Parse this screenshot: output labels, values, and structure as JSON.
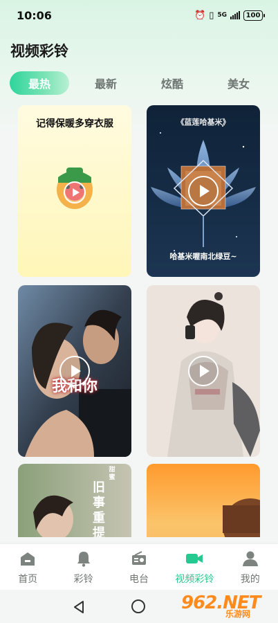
{
  "status_bar": {
    "time": "10:06",
    "network": "5G",
    "battery": "100"
  },
  "page": {
    "title": "视频彩铃"
  },
  "tabs": [
    {
      "label": "最热",
      "active": true
    },
    {
      "label": "最新",
      "active": false
    },
    {
      "label": "炫酷",
      "active": false
    },
    {
      "label": "美女",
      "active": false
    }
  ],
  "videos": [
    {
      "caption": "记得保暖多穿衣服"
    },
    {
      "caption_top": "《蓝莲哈基米》",
      "caption_bottom": "哈基米喔南北绿豆~"
    },
    {
      "caption": "我和你"
    },
    {
      "caption": ""
    },
    {
      "caption": "旧事重提",
      "caption_small": "甜蜜"
    },
    {
      "caption": ""
    }
  ],
  "bottom_nav": [
    {
      "label": "首页",
      "icon": "home-icon",
      "active": false
    },
    {
      "label": "彩铃",
      "icon": "bell-icon",
      "active": false
    },
    {
      "label": "电台",
      "icon": "radio-icon",
      "active": false
    },
    {
      "label": "视频彩铃",
      "icon": "video-camera-icon",
      "active": true
    },
    {
      "label": "我的",
      "icon": "user-icon",
      "active": false
    }
  ],
  "watermark": {
    "text": "962.NET",
    "subtext": "乐游网"
  },
  "colors": {
    "accent": "#26c98f",
    "tab_active_start": "#2fd59c",
    "watermark": "#ff8a1e"
  }
}
